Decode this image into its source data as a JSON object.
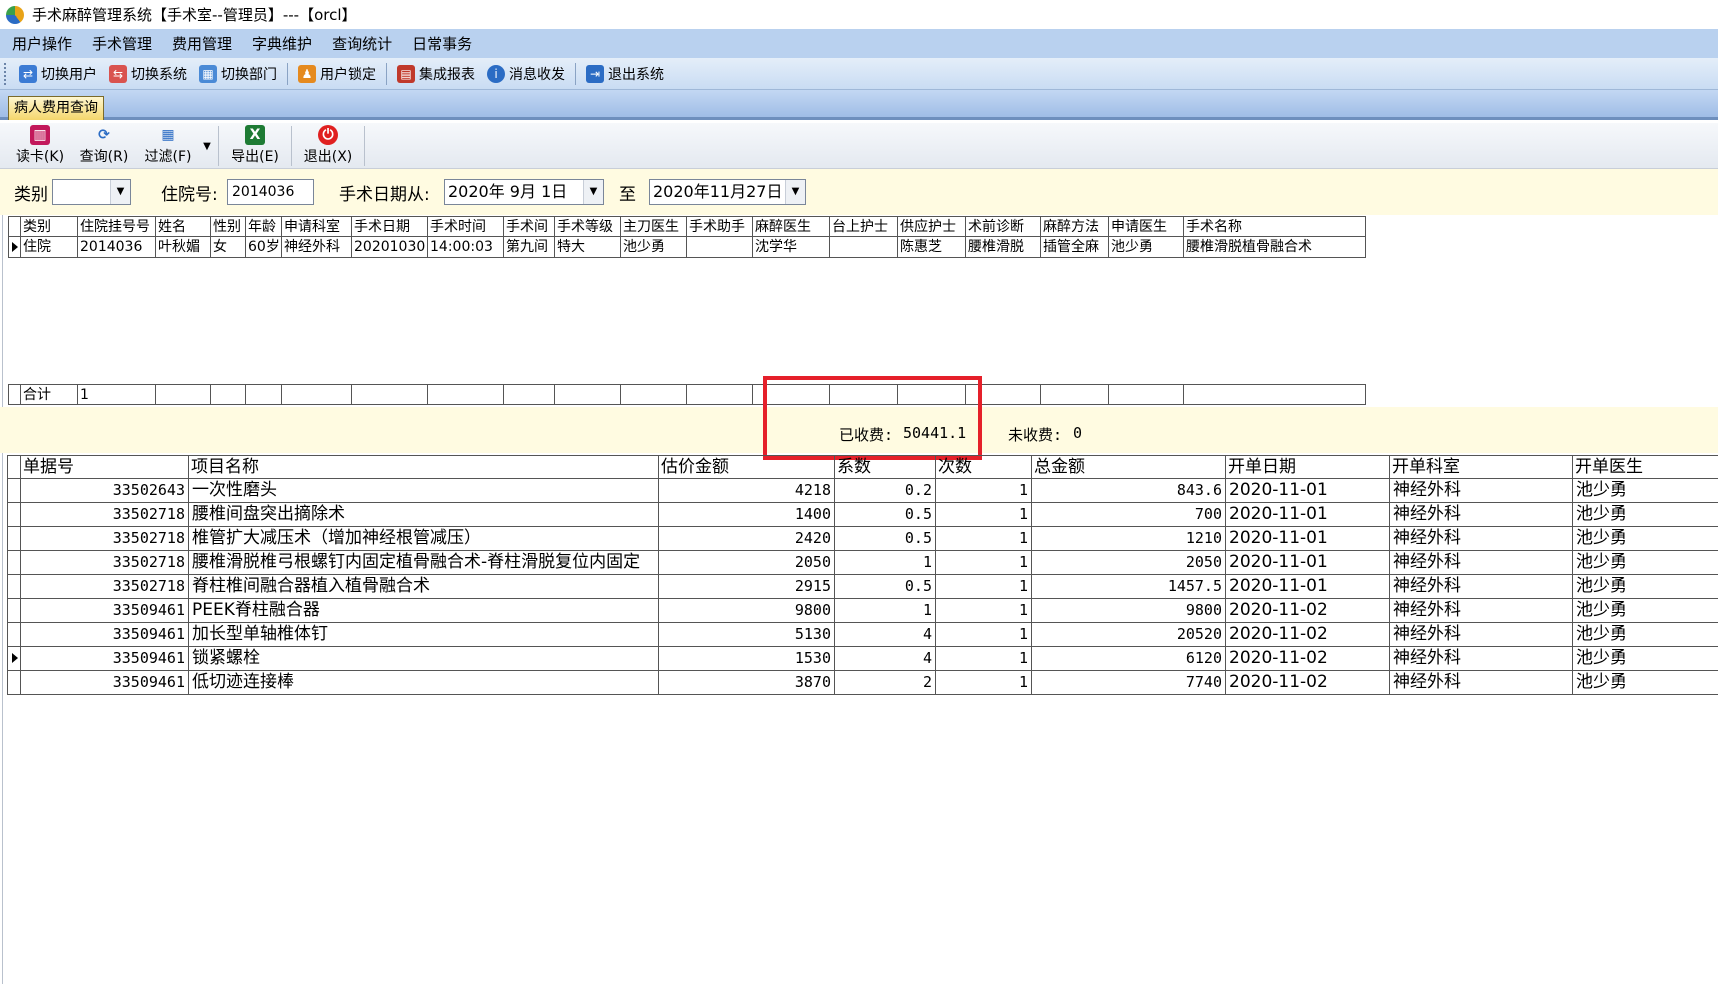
{
  "window": {
    "title": "手术麻醉管理系统【手术室--管理员】---【orcl】"
  },
  "menu": [
    "用户操作",
    "手术管理",
    "费用管理",
    "字典维护",
    "查询统计",
    "日常事务"
  ],
  "systoolbar": [
    {
      "label": "切换用户",
      "icon": "switch-user-icon",
      "color": "#3b7bd4"
    },
    {
      "label": "切换系统",
      "icon": "switch-system-icon",
      "color": "#d9534f"
    },
    {
      "label": "切换部门",
      "icon": "switch-dept-icon",
      "color": "#4a8ad6"
    },
    {
      "label": "用户锁定",
      "icon": "user-lock-icon",
      "color": "#e58a1f"
    },
    {
      "label": "集成报表",
      "icon": "report-icon",
      "color": "#c0392b"
    },
    {
      "label": "消息收发",
      "icon": "info-icon",
      "color": "#2b6cc4"
    },
    {
      "label": "退出系统",
      "icon": "exit-icon",
      "color": "#2b6cc4"
    }
  ],
  "tab": {
    "label": "病人费用查询"
  },
  "formtoolbar": [
    {
      "label": "读卡(K)",
      "icon": "card-reader-icon",
      "color": "#c2185b"
    },
    {
      "label": "查询(R)",
      "icon": "refresh-icon",
      "color": "#2b6cc4"
    },
    {
      "label": "过滤(F)",
      "icon": "filter-icon",
      "color": "#2b6cc4"
    },
    {
      "label": "导出(E)",
      "icon": "excel-export-icon",
      "color": "#1e7b34"
    },
    {
      "label": "退出(X)",
      "icon": "power-icon",
      "color": "#e02020"
    }
  ],
  "filter": {
    "category_label": "类别",
    "category_value": "",
    "admission_label": "住院号:",
    "admission_value": "2014036",
    "date_label": "手术日期从:",
    "date_from": "2020年 9月 1日",
    "to_label": "至",
    "date_to": "2020年11月27日"
  },
  "surgery_grid": {
    "columns": [
      "类别",
      "住院挂号号",
      "姓名",
      "性别",
      "年龄",
      "申请科室",
      "手术日期",
      "手术时间",
      "手术间",
      "手术等级",
      "主刀医生",
      "手术助手",
      "麻醉医生",
      "台上护士",
      "供应护士",
      "术前诊断",
      "麻醉方法",
      "申请医生",
      "手术名称"
    ],
    "rows": [
      [
        "住院",
        "2014036",
        "叶秋媚",
        "女",
        "60岁",
        "神经外科",
        "20201030",
        "14:00:03",
        "第九间",
        "特大",
        "池少勇",
        "",
        "沈学华",
        "",
        "陈惠芝",
        "腰椎滑脱",
        "插管全麻",
        "池少勇",
        "腰椎滑脱植骨融合术"
      ]
    ],
    "footer_label": "合计",
    "footer_count": "1"
  },
  "summary": {
    "paid_label": "已收费:",
    "paid_value": "50441.1",
    "unpaid_label": "未收费:",
    "unpaid_value": "0"
  },
  "fee_grid": {
    "columns": [
      "单据号",
      "项目名称",
      "估价金额",
      "系数",
      "次数",
      "总金额",
      "开单日期",
      "开单科室",
      "开单医生"
    ],
    "rows": [
      [
        "33502643",
        "一次性磨头",
        "4218",
        "0.2",
        "1",
        "843.6",
        "2020-11-01",
        "神经外科",
        "池少勇"
      ],
      [
        "33502718",
        "腰椎间盘突出摘除术",
        "1400",
        "0.5",
        "1",
        "700",
        "2020-11-01",
        "神经外科",
        "池少勇"
      ],
      [
        "33502718",
        "椎管扩大减压术（增加神经根管减压）",
        "2420",
        "0.5",
        "1",
        "1210",
        "2020-11-01",
        "神经外科",
        "池少勇"
      ],
      [
        "33502718",
        "腰椎滑脱椎弓根螺钉内固定植骨融合术-脊柱滑脱复位内固定",
        "2050",
        "1",
        "1",
        "2050",
        "2020-11-01",
        "神经外科",
        "池少勇"
      ],
      [
        "33502718",
        "脊柱椎间融合器植入植骨融合术",
        "2915",
        "0.5",
        "1",
        "1457.5",
        "2020-11-01",
        "神经外科",
        "池少勇"
      ],
      [
        "33509461",
        "PEEK脊柱融合器",
        "9800",
        "1",
        "1",
        "9800",
        "2020-11-02",
        "神经外科",
        "池少勇"
      ],
      [
        "33509461",
        "加长型单轴椎体钉",
        "5130",
        "4",
        "1",
        "20520",
        "2020-11-02",
        "神经外科",
        "池少勇"
      ],
      [
        "33509461",
        "锁紧螺栓",
        "1530",
        "4",
        "1",
        "6120",
        "2020-11-02",
        "神经外科",
        "池少勇"
      ],
      [
        "33509461",
        "低切迹连接棒",
        "3870",
        "2",
        "1",
        "7740",
        "2020-11-02",
        "神经外科",
        "池少勇"
      ]
    ],
    "current_row": 7
  }
}
